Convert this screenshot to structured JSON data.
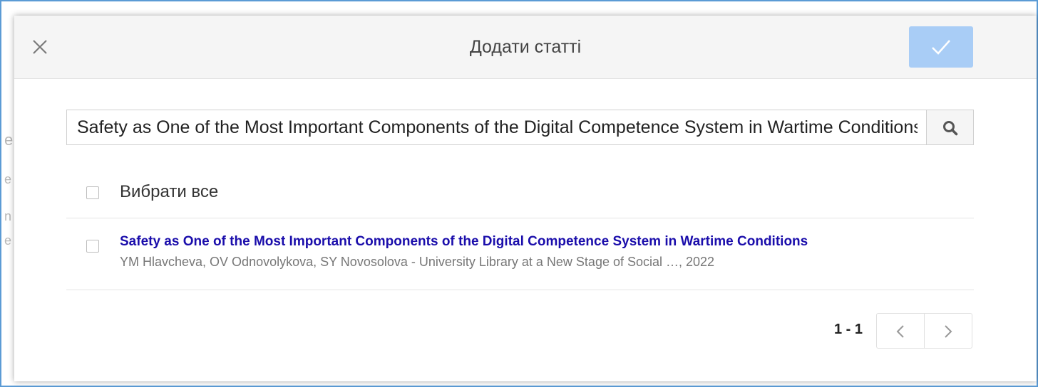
{
  "dialog": {
    "title": "Додати статті",
    "close_icon": "close-icon",
    "confirm_icon": "checkmark-icon",
    "confirm_color": "#a9cdf6"
  },
  "search": {
    "value": "Safety as One of the Most Important Components of the Digital Competence System in Wartime Conditions",
    "icon": "search-icon"
  },
  "select_all": {
    "label": "Вибрати все"
  },
  "results": [
    {
      "title": "Safety as One of the Most Important Components of the Digital Competence System in Wartime Conditions",
      "meta": "YM Hlavcheva, OV Odnovolykova, SY Novosolova - University Library at a New Stage of Social …, 2022",
      "title_color": "#1a0dab"
    }
  ],
  "pagination": {
    "range": "1 - 1",
    "prev_icon": "chevron-left-icon",
    "next_icon": "chevron-right-icon"
  }
}
